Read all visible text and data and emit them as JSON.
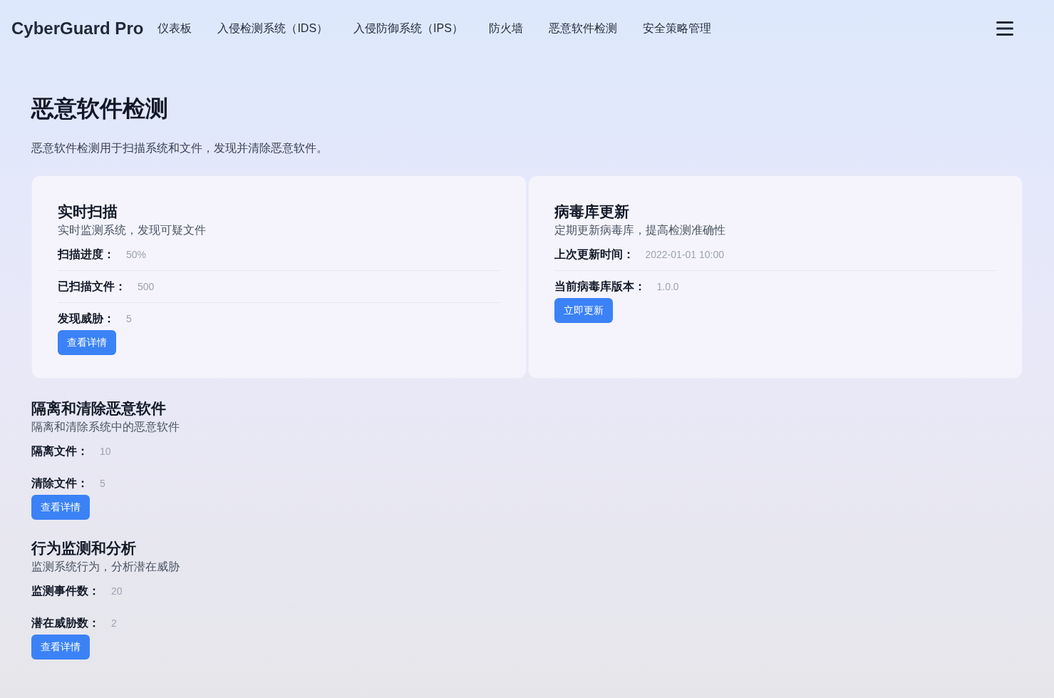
{
  "brand": "CyberGuard Pro",
  "nav": [
    "仪表板",
    "入侵检测系统（IDS）",
    "入侵防御系统（IPS）",
    "防火墙",
    "恶意软件检测",
    "安全策略管理"
  ],
  "page": {
    "title": "恶意软件检测",
    "description": "恶意软件检测用于扫描系统和文件，发现并清除恶意软件。"
  },
  "sections": [
    {
      "kind": "card",
      "title": "实时扫描",
      "subtitle": "实时监测系统，发现可疑文件",
      "fields": [
        {
          "label": "扫描进度：",
          "value": "50%"
        },
        {
          "label": "已扫描文件：",
          "value": "500"
        },
        {
          "label": "发现威胁：",
          "value": "5"
        }
      ],
      "button": "查看详情"
    },
    {
      "kind": "card",
      "title": "病毒库更新",
      "subtitle": "定期更新病毒库，提高检测准确性",
      "fields": [
        {
          "label": "上次更新时间：",
          "value": "2022-01-01 10:00"
        },
        {
          "label": "当前病毒库版本：",
          "value": "1.0.0"
        }
      ],
      "button": "立即更新"
    },
    {
      "kind": "plain",
      "title": "隔离和清除恶意软件",
      "subtitle": "隔离和清除系统中的恶意软件",
      "fields": [
        {
          "label": "隔离文件：",
          "value": "10"
        },
        {
          "label": "清除文件：",
          "value": "5"
        }
      ],
      "button": "查看详情"
    },
    {
      "kind": "plain",
      "title": "行为监测和分析",
      "subtitle": "监测系统行为，分析潜在威胁",
      "fields": [
        {
          "label": "监测事件数：",
          "value": "20"
        },
        {
          "label": "潜在威胁数：",
          "value": "2"
        }
      ],
      "button": "查看详情"
    }
  ]
}
